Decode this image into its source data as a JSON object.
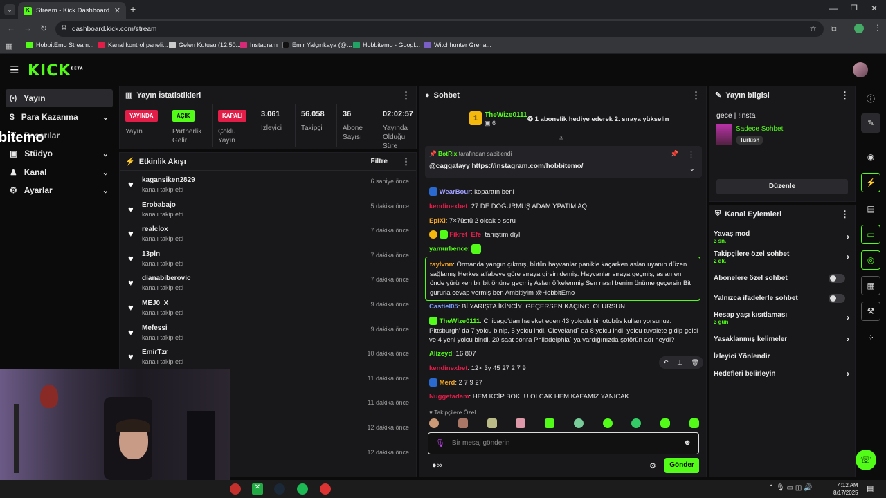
{
  "browser": {
    "tab_title": "Stream - Kick Dashboard",
    "url": "dashboard.kick.com/stream",
    "bookmarks": [
      "HobbitEmo Stream...",
      "Kanal kontrol paneli...",
      "Gelen Kutusu (12.50...",
      "Instagram",
      "Emir Yalçınkaya (@...",
      "Hobbitemo - Googl...",
      "Witchhunter Grena..."
    ]
  },
  "brand": {
    "logo": "KICK",
    "beta": "BETA",
    "accent": "#53fc18"
  },
  "nav": {
    "items": [
      {
        "label": "Yayın",
        "icon": "broadcast-icon"
      },
      {
        "label": "Para Kazanma",
        "icon": "dollar-icon",
        "expand": true
      },
      {
        "label": "Başarılar",
        "icon": "trophy-icon"
      },
      {
        "label": "Stüdyo",
        "icon": "studio-icon",
        "expand": true
      },
      {
        "label": "Kanal",
        "icon": "user-icon",
        "expand": true
      },
      {
        "label": "Ayarlar",
        "icon": "gear-icon",
        "expand": true
      }
    ],
    "overlay_text": "bitemo"
  },
  "stats": {
    "title": "Yayın İstatistikleri",
    "items": [
      {
        "badge": "YAYINDA",
        "badge_color": "#e11d48",
        "label": "Yayın"
      },
      {
        "badge": "AÇIK",
        "badge_color": "#53fc18",
        "label": "Partnerlik Gelir"
      },
      {
        "badge": "KAPALI",
        "badge_color": "#e11d48",
        "label": "Çoklu Yayın"
      },
      {
        "value": "3.061",
        "label": "İzleyici"
      },
      {
        "value": "56.058",
        "label": "Takipçi"
      },
      {
        "value": "36",
        "label": "Abone Sayısı"
      },
      {
        "value": "02:02:57",
        "label": "Yayında Olduğu Süre"
      }
    ]
  },
  "activity": {
    "title": "Etkinlik Akışı",
    "filter": "Filtre",
    "items": [
      {
        "name": "kagansiken2829",
        "sub": "kanalı takip etti",
        "time": "6 saniye önce"
      },
      {
        "name": "Erobabajo",
        "sub": "kanalı takip etti",
        "time": "5 dakika önce"
      },
      {
        "name": "realclox",
        "sub": "kanalı takip etti",
        "time": "7 dakika önce"
      },
      {
        "name": "13pln",
        "sub": "kanalı takip etti",
        "time": "7 dakika önce"
      },
      {
        "name": "dianabiberovic",
        "sub": "kanalı takip etti",
        "time": "7 dakika önce"
      },
      {
        "name": "MEJ0_X",
        "sub": "kanalı takip etti",
        "time": "9 dakika önce"
      },
      {
        "name": "Mefessi",
        "sub": "kanalı takip etti",
        "time": "9 dakika önce"
      },
      {
        "name": "EmirTzr",
        "sub": "kanalı takip etti",
        "time": "10 dakika önce"
      },
      {
        "name": "",
        "sub": "",
        "time": "11 dakika önce"
      },
      {
        "name": "",
        "sub": "",
        "time": "11 dakika önce"
      },
      {
        "name": "",
        "sub": "",
        "time": "12 dakika önce"
      },
      {
        "name": "",
        "sub": "",
        "time": "12 dakika önce"
      }
    ]
  },
  "chat": {
    "title": "Sohbet",
    "gift": {
      "rank": "1",
      "user": "TheWize0111",
      "count": "6",
      "text": "1 abonelik hediye ederek 2. sıraya yükselin"
    },
    "pinned": {
      "by": "BotRix",
      "by_text": "tarafından sabitlendi",
      "user": "@caggatayy",
      "link": "https://instagram.com/hobbitemo/"
    },
    "messages": [
      {
        "user": "WearBour",
        "color": "#a0a0ff",
        "text": "koparttın beni"
      },
      {
        "user": "kendinexbet",
        "color": "#e11d48",
        "text": "27 DE DOĞURMUŞ ADAM YPATIM AQ"
      },
      {
        "user": "EpiXl",
        "color": "#f5a623",
        "text": "7×7üstü 2 olcak o soru"
      },
      {
        "user": "Fikret_Efe",
        "color": "#e11d48",
        "text": "tanıştım diyl"
      },
      {
        "user": "yamurbence",
        "color": "#53fc18",
        "text": ""
      },
      {
        "user": "taylvnn",
        "color": "#f5a623",
        "text": "Ormanda yangın çıkmış, bütün hayvanlar panikle kaçarken aslan uyanıp düzen sağlamış Herkes alfabeye göre sıraya girsin demiş. Hayvanlar sıraya geçmiş, aslan en önde yürürken bir bit önüne geçmiş Aslan öfkelenmiş Sen nasıl benim önüme geçersin Bit gururla cevap vermiş ben Ambitiyim @HobbitEmo"
      },
      {
        "user": "Castiel05",
        "color": "#7aa2ff",
        "text": "Bİ YARIŞTA İKİNCİYİ GEÇERSEN KAÇINCI OLURSUN"
      },
      {
        "user": "TheWize0111",
        "color": "#53fc18",
        "text": "Chicago'dan hareket eden 43 yolculu bir otobüs kullanıyorsunuz. Pittsburgh' da 7 yolcu binip, 5 yolcu indi. Cleveland` da 8 yolcu indi, yolcu tuvalete gidip geldi ve 4 yeni yolcu bindi. 20 saat sonra Philadelphia` ya vardığınızda şoförün adı neydi?"
      },
      {
        "user": "Alizeyd",
        "color": "#53fc18",
        "text": "16.807"
      },
      {
        "user": "kendinexbet",
        "color": "#e11d48",
        "text": "12× 3y 45 27 2 7 9"
      },
      {
        "user": "Merd",
        "color": "#f5a623",
        "text": "2 7 9 27"
      },
      {
        "user": "Nuggetadam",
        "color": "#e11d48",
        "text": "HEM KCİP BOKLU OLCAK HEM KAFAMIZ YANICAK"
      }
    ],
    "followers_only": "Takipçilere Özel",
    "input_placeholder": "Bir mesaj gönderin",
    "send": "Gönder"
  },
  "info": {
    "title": "Yayın bilgisi",
    "stream_title": "gece | !insta",
    "category": "Sadece Sohbet",
    "language": "Turkish",
    "edit": "Düzenle"
  },
  "actions": {
    "title": "Kanal Eylemleri",
    "items": [
      {
        "label": "Yavaş mod",
        "sub": "3 sn.",
        "kind": "arrow"
      },
      {
        "label": "Takipçilere özel sohbet",
        "sub": "2 dk.",
        "kind": "arrow"
      },
      {
        "label": "Abonelere özel sohbet",
        "sub": "",
        "kind": "toggle"
      },
      {
        "label": "Yalnızca ifadelerle sohbet",
        "sub": "",
        "kind": "toggle"
      },
      {
        "label": "Hesap yaşı kısıtlaması",
        "sub": "3 gün",
        "kind": "arrow"
      },
      {
        "label": "Yasaklanmış kelimeler",
        "sub": "",
        "kind": "arrow"
      },
      {
        "label": "İzleyici Yönlendir",
        "sub": "",
        "kind": "none"
      },
      {
        "label": "Hedefleri belirleyin",
        "sub": "",
        "kind": "arrow"
      }
    ]
  },
  "taskbar": {
    "time": "4:12 AM",
    "date": "8/17/2025"
  }
}
